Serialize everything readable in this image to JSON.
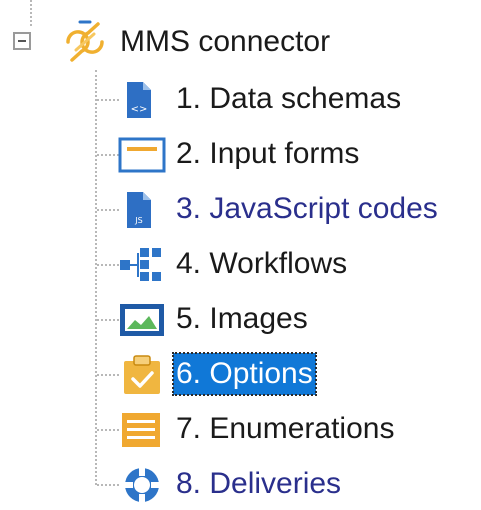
{
  "tree": {
    "root": {
      "label": "MMS connector",
      "icon": "connector-icon",
      "expanded": true
    },
    "items": [
      {
        "label": "1. Data schemas",
        "icon": "data-schema-file-icon",
        "style": "normal"
      },
      {
        "label": "2. Input forms",
        "icon": "input-form-window-icon",
        "style": "normal"
      },
      {
        "label": "3. JavaScript codes",
        "icon": "javascript-file-icon",
        "style": "link"
      },
      {
        "label": "4. Workflows",
        "icon": "workflow-icon",
        "style": "normal"
      },
      {
        "label": "5. Images",
        "icon": "image-icon",
        "style": "normal"
      },
      {
        "label": "6. Options",
        "icon": "options-clipboard-icon",
        "style": "selected"
      },
      {
        "label": "7. Enumerations",
        "icon": "enumeration-list-icon",
        "style": "normal"
      },
      {
        "label": "8. Deliveries",
        "icon": "delivery-icon",
        "style": "link"
      }
    ]
  },
  "colors": {
    "selection_background": "#1078d7",
    "link_text": "#2a2f8c",
    "orange_accent": "#f0a830",
    "blue_accent": "#2e75c8"
  }
}
